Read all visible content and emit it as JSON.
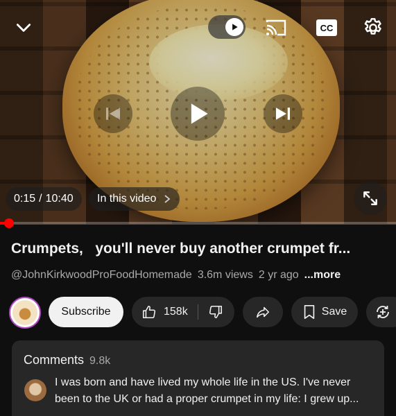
{
  "player": {
    "time_current": "0:15",
    "time_separator": "/",
    "time_total": "10:40",
    "chapters_label": "In this video",
    "progress_fraction": 0.023,
    "icons": [
      "chevron-down-icon",
      "autoplay-icon",
      "cast-icon",
      "cc-icon",
      "settings-icon",
      "previous-icon",
      "play-icon",
      "next-icon",
      "fullscreen-icon",
      "chevron-right-icon"
    ],
    "cc_label": "CC"
  },
  "video": {
    "title": "Crumpets,   you'll never buy another crumpet fr...",
    "channel_handle": "@JohnKirkwoodProFoodHomemade",
    "views": "3.6m views",
    "age": "2 yr ago",
    "more_label": "...more"
  },
  "actions": {
    "subscribe_label": "Subscribe",
    "like_count": "158k",
    "save_label": "Save"
  },
  "comments": {
    "label": "Comments",
    "count": "9.8k",
    "top_comment_line1": "I was born and have lived my whole life in the US. I've never",
    "top_comment_line2": "been to the UK or had a proper crumpet in my life: I grew up..."
  },
  "colors": {
    "background": "#0f0f0f",
    "progress": "#ff0000",
    "pill": "#272727",
    "subscribe_bg": "#f1f1f1",
    "secondary_text": "#aaaaaa"
  }
}
